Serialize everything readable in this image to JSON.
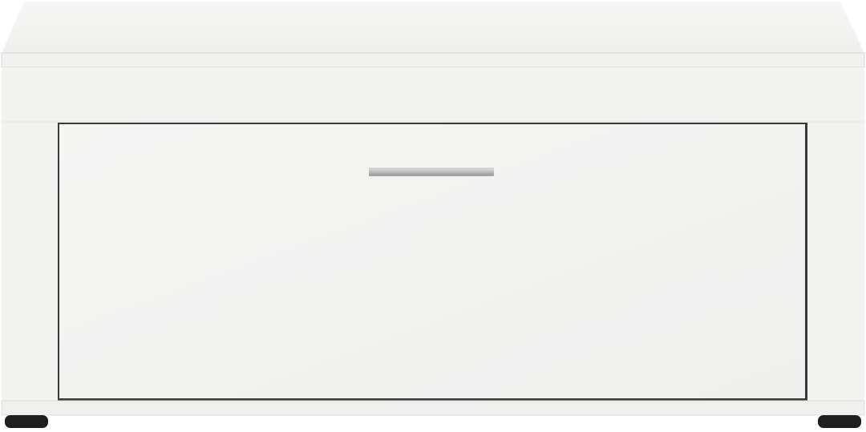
{
  "product": {
    "subject": "white-shoe-cabinet",
    "colors": {
      "body": "#f2f2f1",
      "top_face": "#f5f5f4",
      "front_edge": "#ededec",
      "drawer_front": "#f3f3f2",
      "drawer_gap": "#3a3a3a",
      "handle": "#c9c9c9",
      "feet": "#1e1e1e"
    },
    "icons": [
      "drawer-handle",
      "cabinet-foot"
    ]
  }
}
